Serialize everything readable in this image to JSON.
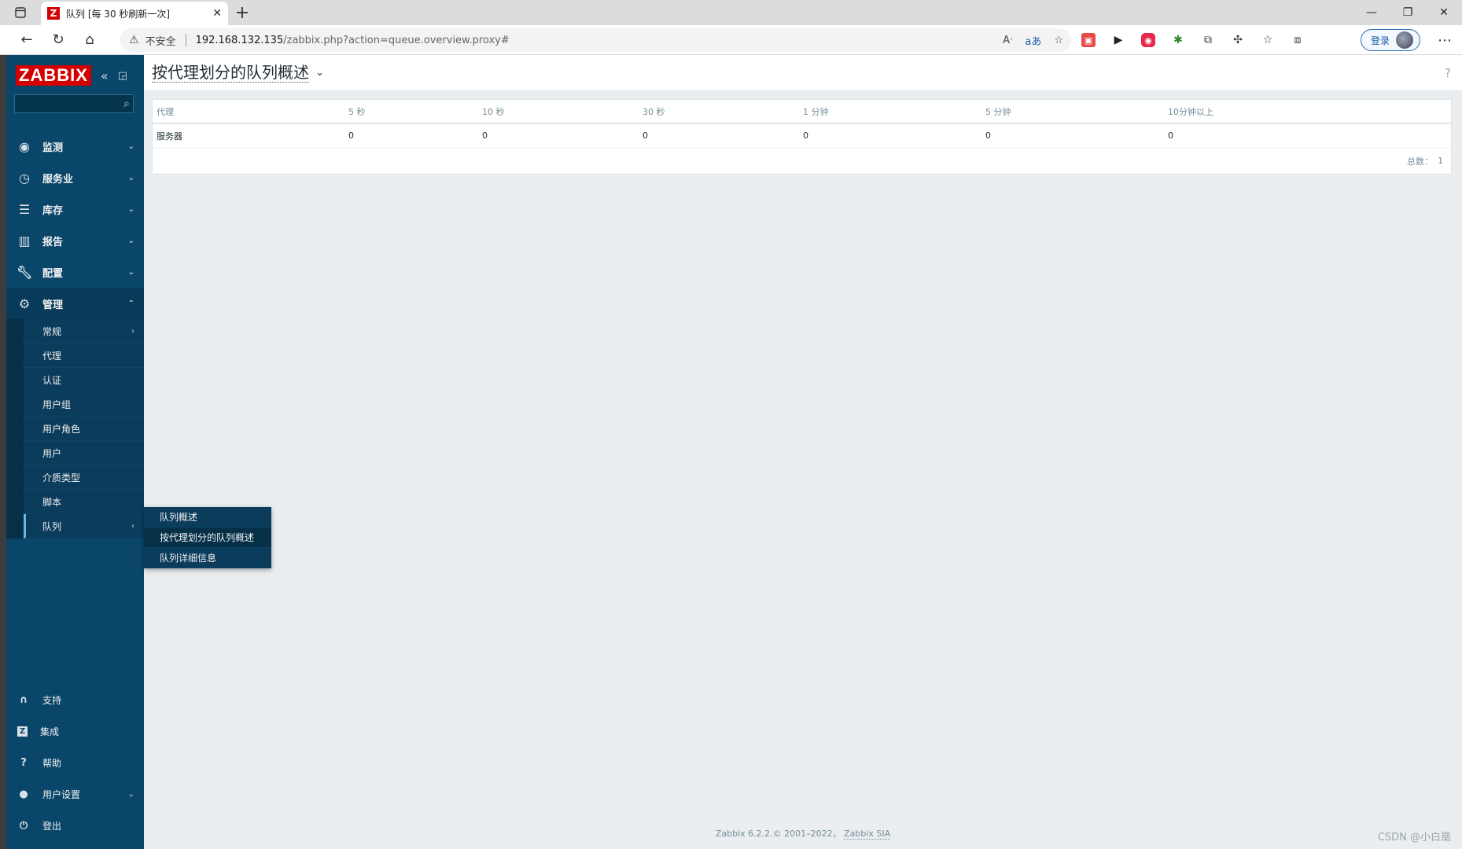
{
  "browser": {
    "tab_title": "队列 [每 30 秒刷新一次]",
    "tab_favicon": "Z",
    "insecure_label": "不安全",
    "url_host": "192.168.132.135",
    "url_path": "/zabbix.php?action=queue.overview.proxy#",
    "login_label": "登录"
  },
  "sidebar": {
    "logo": "ZABBIX",
    "search_placeholder": "",
    "menu": [
      {
        "label": "监测",
        "icon": "eye-icon"
      },
      {
        "label": "服务业",
        "icon": "clock-icon"
      },
      {
        "label": "库存",
        "icon": "list-icon"
      },
      {
        "label": "报告",
        "icon": "bar-chart-icon"
      },
      {
        "label": "配置",
        "icon": "wrench-icon"
      },
      {
        "label": "管理",
        "icon": "gear-icon"
      }
    ],
    "admin_submenu": [
      "常规",
      "代理",
      "认证",
      "用户组",
      "用户角色",
      "用户",
      "介质类型",
      "脚本",
      "队列"
    ],
    "queue_flyout": [
      "队列概述",
      "按代理划分的队列概述",
      "队列详细信息"
    ],
    "bottom": [
      {
        "label": "支持",
        "icon": "headset-icon"
      },
      {
        "label": "集成",
        "icon": "zabbix-z-icon"
      },
      {
        "label": "帮助",
        "icon": "question-icon"
      },
      {
        "label": "用户设置",
        "icon": "user-icon"
      },
      {
        "label": "登出",
        "icon": "power-icon"
      }
    ]
  },
  "page": {
    "title": "按代理划分的队列概述",
    "help": "?"
  },
  "table": {
    "headers": [
      "代理",
      "5 秒",
      "10 秒",
      "30 秒",
      "1 分钟",
      "5 分钟",
      "10分钟以上"
    ],
    "rows": [
      [
        "服务器",
        "0",
        "0",
        "0",
        "0",
        "0",
        "0"
      ]
    ],
    "total_label": "总数：",
    "total_value": "1"
  },
  "footer": {
    "text": "Zabbix 6.2.2.© 2001–2022，",
    "link": "Zabbix SIA"
  },
  "watermark": "CSDN @小白凰"
}
